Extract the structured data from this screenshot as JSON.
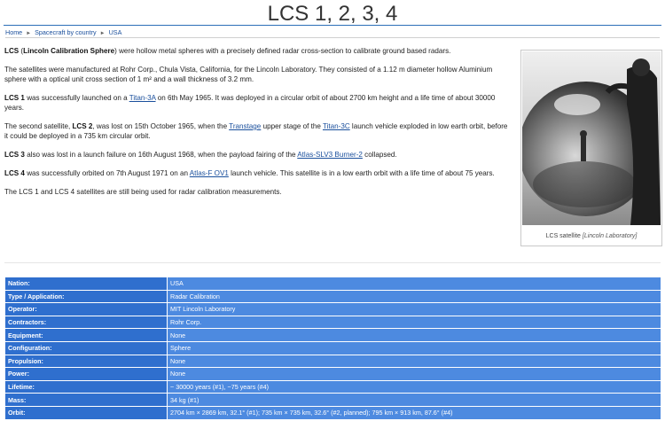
{
  "page": {
    "title": "LCS 1, 2, 3, 4"
  },
  "breadcrumb": {
    "items": [
      "Home",
      "Spacecraft by country",
      "USA"
    ],
    "separator": "►"
  },
  "article": {
    "p1": {
      "bold": "LCS",
      "open": " (",
      "bold2": "Lincoln Calibration Sphere",
      "rest": ") were hollow metal spheres with a precisely defined radar cross-section to calibrate ground based radars."
    },
    "p2": "The satellites were manufactured at Rohr Corp., Chula Vista, California, for the Lincoln Laboratory. They consisted of a 1.12 m diameter hollow Aluminium sphere with a optical unit cross section of 1 m² and a wall thickness of 3.2 mm.",
    "p3": {
      "bold": "LCS 1",
      "pre": " was successfully launched on a ",
      "link": "Titan-3A",
      "post": " on 6th May 1965. It was deployed in a circular orbit of about 2700 km height and a life time of about 30000 years."
    },
    "p4": {
      "pre": "The second satellite, ",
      "bold": "LCS 2",
      "mid": ", was lost on 15th October 1965, when the ",
      "link1": "Transtage",
      "mid2": " upper stage of the ",
      "link2": "Titan-3C",
      "post": " launch vehicle exploded in low earth orbit, before it could be deployed in a 735 km circular orbit."
    },
    "p5": {
      "bold": "LCS 3",
      "pre": " also was lost in a launch failure on 16th August 1968, when the payload fairing of the ",
      "link": "Atlas-SLV3 Burner-2",
      "post": " collapsed."
    },
    "p6": {
      "bold": "LCS 4",
      "pre": " was successfully orbited on 7th August 1971 on an ",
      "link": "Atlas-F OV1",
      "post": " launch vehicle. This satellite is in a low earth orbit with a life time of about 75 years."
    },
    "p7": "The LCS 1 and LCS 4 satellites are still being used for radar calibration measurements."
  },
  "figure": {
    "caption": "LCS satellite",
    "credit": "[Lincoln Laboratory]"
  },
  "specs": [
    {
      "key": "Nation:",
      "value": "USA"
    },
    {
      "key": "Type / Application:",
      "value": "Radar Calibration"
    },
    {
      "key": "Operator:",
      "value": "MIT Lincoln Laboratory"
    },
    {
      "key": "Contractors:",
      "value": "Rohr Corp."
    },
    {
      "key": "Equipment:",
      "value": "None"
    },
    {
      "key": "Configuration:",
      "value": "Sphere"
    },
    {
      "key": "Propulsion:",
      "value": "None"
    },
    {
      "key": "Power:",
      "value": "None"
    },
    {
      "key": "Lifetime:",
      "value": "~ 30000 years (#1), ~75 years (#4)"
    },
    {
      "key": "Mass:",
      "value": "34 kg (#1)"
    },
    {
      "key": "Orbit:",
      "value": "2704 km × 2869 km, 32.1° (#1); 735 km × 735 km, 32.6° (#2, planned); 795 km × 913 km, 87.6° (#4)"
    }
  ],
  "colors": {
    "accent_rule": "#2b6fb8",
    "link": "#1a4f9c",
    "table_key_bg": "#2f6fce",
    "table_val_bg": "#4d8ae0"
  }
}
